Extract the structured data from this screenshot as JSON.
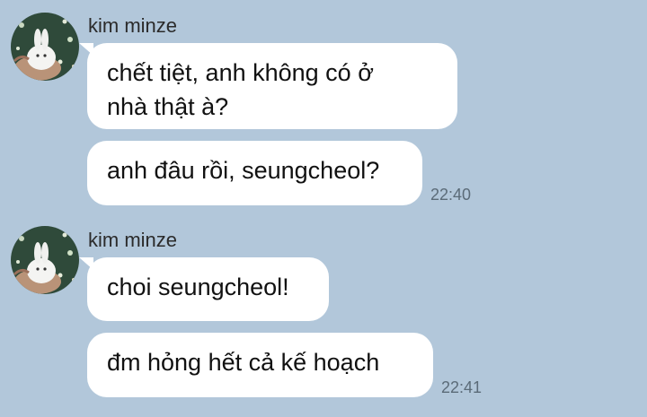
{
  "groups": [
    {
      "sender": "kim minze",
      "avatar_icon": "bunny-avatar-icon",
      "messages": [
        {
          "text": "chết tiệt, anh không có ở\nnhà thật à?"
        },
        {
          "text": "anh đâu rồi, seungcheol?",
          "time": "22:40"
        }
      ]
    },
    {
      "sender": "kim minze",
      "avatar_icon": "bunny-avatar-icon",
      "messages": [
        {
          "text": "choi seungcheol!"
        },
        {
          "text": "đm hỏng hết cả kế hoạch",
          "time": "22:41"
        }
      ]
    }
  ],
  "colors": {
    "background": "#b2c7da",
    "bubble": "#ffffff"
  }
}
